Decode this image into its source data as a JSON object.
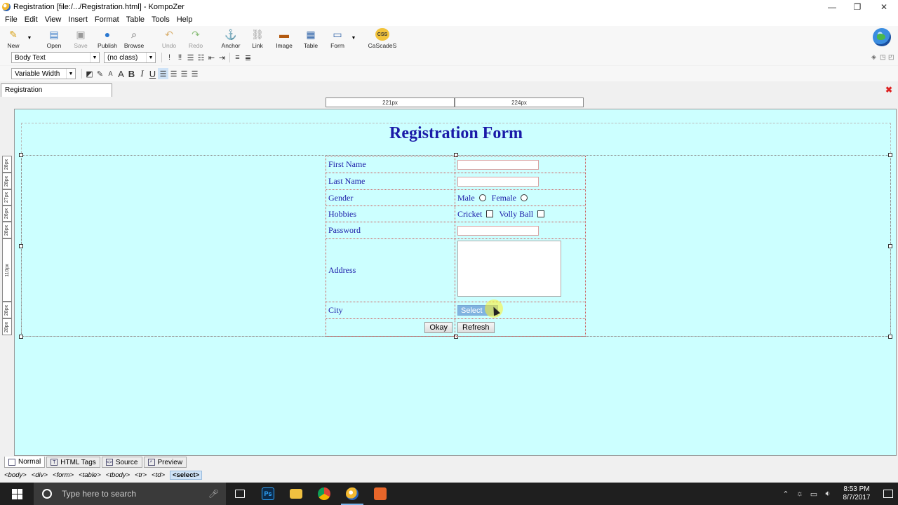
{
  "window": {
    "title": "Registration [file:/.../Registration.html] - KompoZer",
    "minimize": "—",
    "maximize": "❐",
    "close": "✕"
  },
  "menu": [
    "File",
    "Edit",
    "View",
    "Insert",
    "Format",
    "Table",
    "Tools",
    "Help"
  ],
  "toolbar": {
    "new": "New",
    "open": "Open",
    "save": "Save",
    "publish": "Publish",
    "browse": "Browse",
    "undo": "Undo",
    "redo": "Redo",
    "anchor": "Anchor",
    "link": "Link",
    "image": "Image",
    "table": "Table",
    "form": "Form",
    "cascades": "CaScadeS",
    "cascades_badge": "CSS"
  },
  "format1": {
    "paragraph_style": "Body Text",
    "class_select": "(no class)"
  },
  "format2": {
    "width_select": "Variable Width",
    "bold": "B",
    "italic": "I",
    "underline": "U"
  },
  "doc_tab": {
    "label": "Registration"
  },
  "rulers": {
    "top": [
      "221px",
      "224px"
    ],
    "left": [
      "28px",
      "28px",
      "27px",
      "26px",
      "28px",
      "110px",
      "28px",
      "28px"
    ]
  },
  "page": {
    "heading": "Registration Form",
    "rows": {
      "first_name": "First Name",
      "last_name": "Last Name",
      "gender": "Gender",
      "gender_male": "Male",
      "gender_female": "Female",
      "hobbies": "Hobbies",
      "hobby_cricket": "Cricket",
      "hobby_volleyball": "Volly Ball",
      "password": "Password",
      "address": "Address",
      "city": "City",
      "city_select": "Select"
    },
    "buttons": {
      "okay": "Okay",
      "refresh": "Refresh"
    }
  },
  "view_tabs": [
    "Normal",
    "HTML Tags",
    "Source",
    "Preview"
  ],
  "tag_path": [
    "<body>",
    "<div>",
    "<form>",
    "<table>",
    "<tbody>",
    "<tr>",
    "<td>",
    "<select>"
  ],
  "taskbar": {
    "search_placeholder": "Type here to search",
    "apps": {
      "photoshop": "Ps"
    },
    "time": "8:53 PM",
    "date": "8/7/2017"
  }
}
